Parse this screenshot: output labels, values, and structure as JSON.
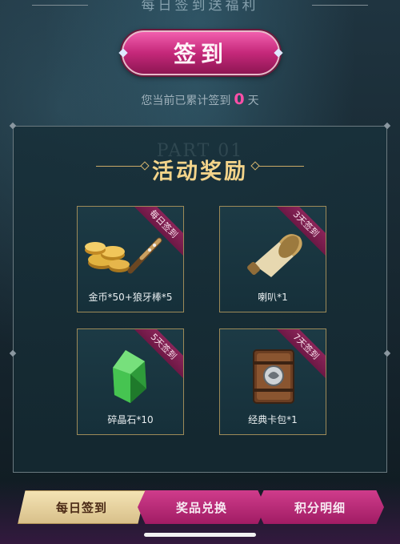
{
  "header": {
    "title": "每日签到送福利",
    "signin_label": "签到",
    "count_prefix": "您当前已累计签到",
    "count_value": "0",
    "count_suffix": "天"
  },
  "panel": {
    "part_text": "PART 01",
    "title": "活动奖励",
    "rewards": [
      {
        "badge": "每日签到",
        "label": "金币*50+狼牙棒*5",
        "icon": "coins-and-club-icon"
      },
      {
        "badge": "3天签到",
        "label": "喇叭*1",
        "icon": "horn-icon"
      },
      {
        "badge": "5天签到",
        "label": "碎晶石*10",
        "icon": "crystal-icon"
      },
      {
        "badge": "7天签到",
        "label": "经典卡包*1",
        "icon": "card-pack-icon"
      }
    ]
  },
  "nav": {
    "tab1": "每日签到",
    "tab2": "奖品兑换",
    "tab3": "积分明细"
  },
  "colors": {
    "accent_pink": "#c5287a",
    "gold": "#f3d48a",
    "count_highlight": "#ff4fa8"
  }
}
